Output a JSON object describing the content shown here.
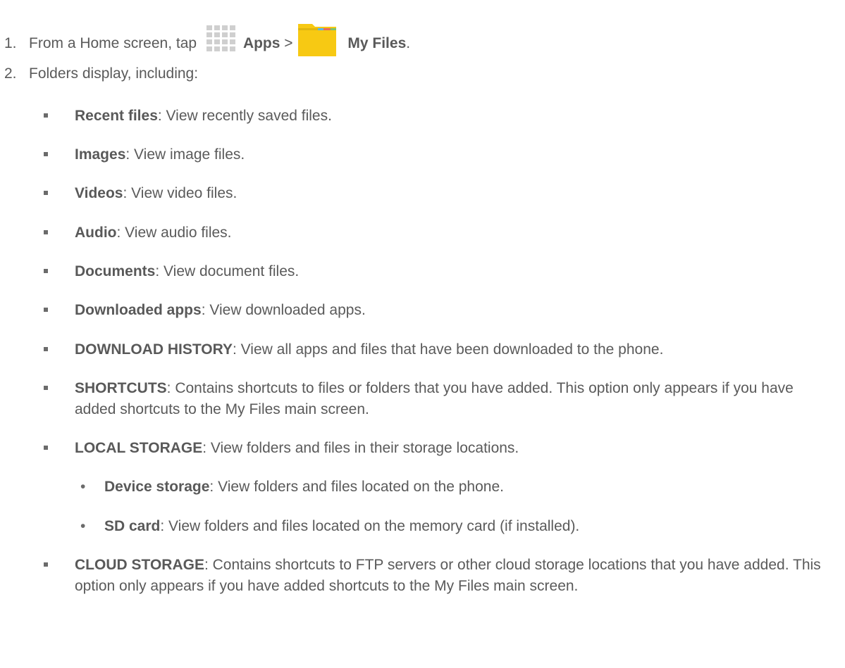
{
  "steps": [
    {
      "num": "1.",
      "pre": "From a Home screen, tap",
      "apps_label": "Apps",
      "sep": ">",
      "files_label": "My Files",
      "end": "."
    },
    {
      "num": "2.",
      "text": "Folders display, including:"
    }
  ],
  "items": [
    {
      "term": "Recent files",
      "desc": ": View recently saved files."
    },
    {
      "term": "Images",
      "desc": ": View image files."
    },
    {
      "term": "Videos",
      "desc": ": View video files."
    },
    {
      "term": "Audio",
      "desc": ": View audio files."
    },
    {
      "term": "Documents",
      "desc": ": View document files."
    },
    {
      "term": "Downloaded apps",
      "desc": ": View downloaded apps."
    },
    {
      "term": "DOWNLOAD HISTORY",
      "desc": ": View all apps and files that have been downloaded to the phone."
    },
    {
      "term": "SHORTCUTS",
      "desc": ": Contains shortcuts to files or folders that you have added. This option only appears if you have added shortcuts to the My Files main screen."
    },
    {
      "term": "LOCAL STORAGE",
      "desc": ": View folders and files in their storage locations."
    },
    {
      "term": "CLOUD STORAGE",
      "desc": ": Contains shortcuts to FTP servers or other cloud storage locations that you have added. This option only appears if you have added shortcuts to the My Files main screen."
    }
  ],
  "sub_items": [
    {
      "term": "Device storage",
      "desc": ": View folders and files located on the phone."
    },
    {
      "term": "SD card",
      "desc": ": View folders and files located on the memory card (if installed)."
    }
  ],
  "icons": {
    "apps": "apps-grid-icon",
    "files": "my-files-folder-icon"
  },
  "colors": {
    "text": "#5a5a5a",
    "folder": "#f7c913"
  }
}
